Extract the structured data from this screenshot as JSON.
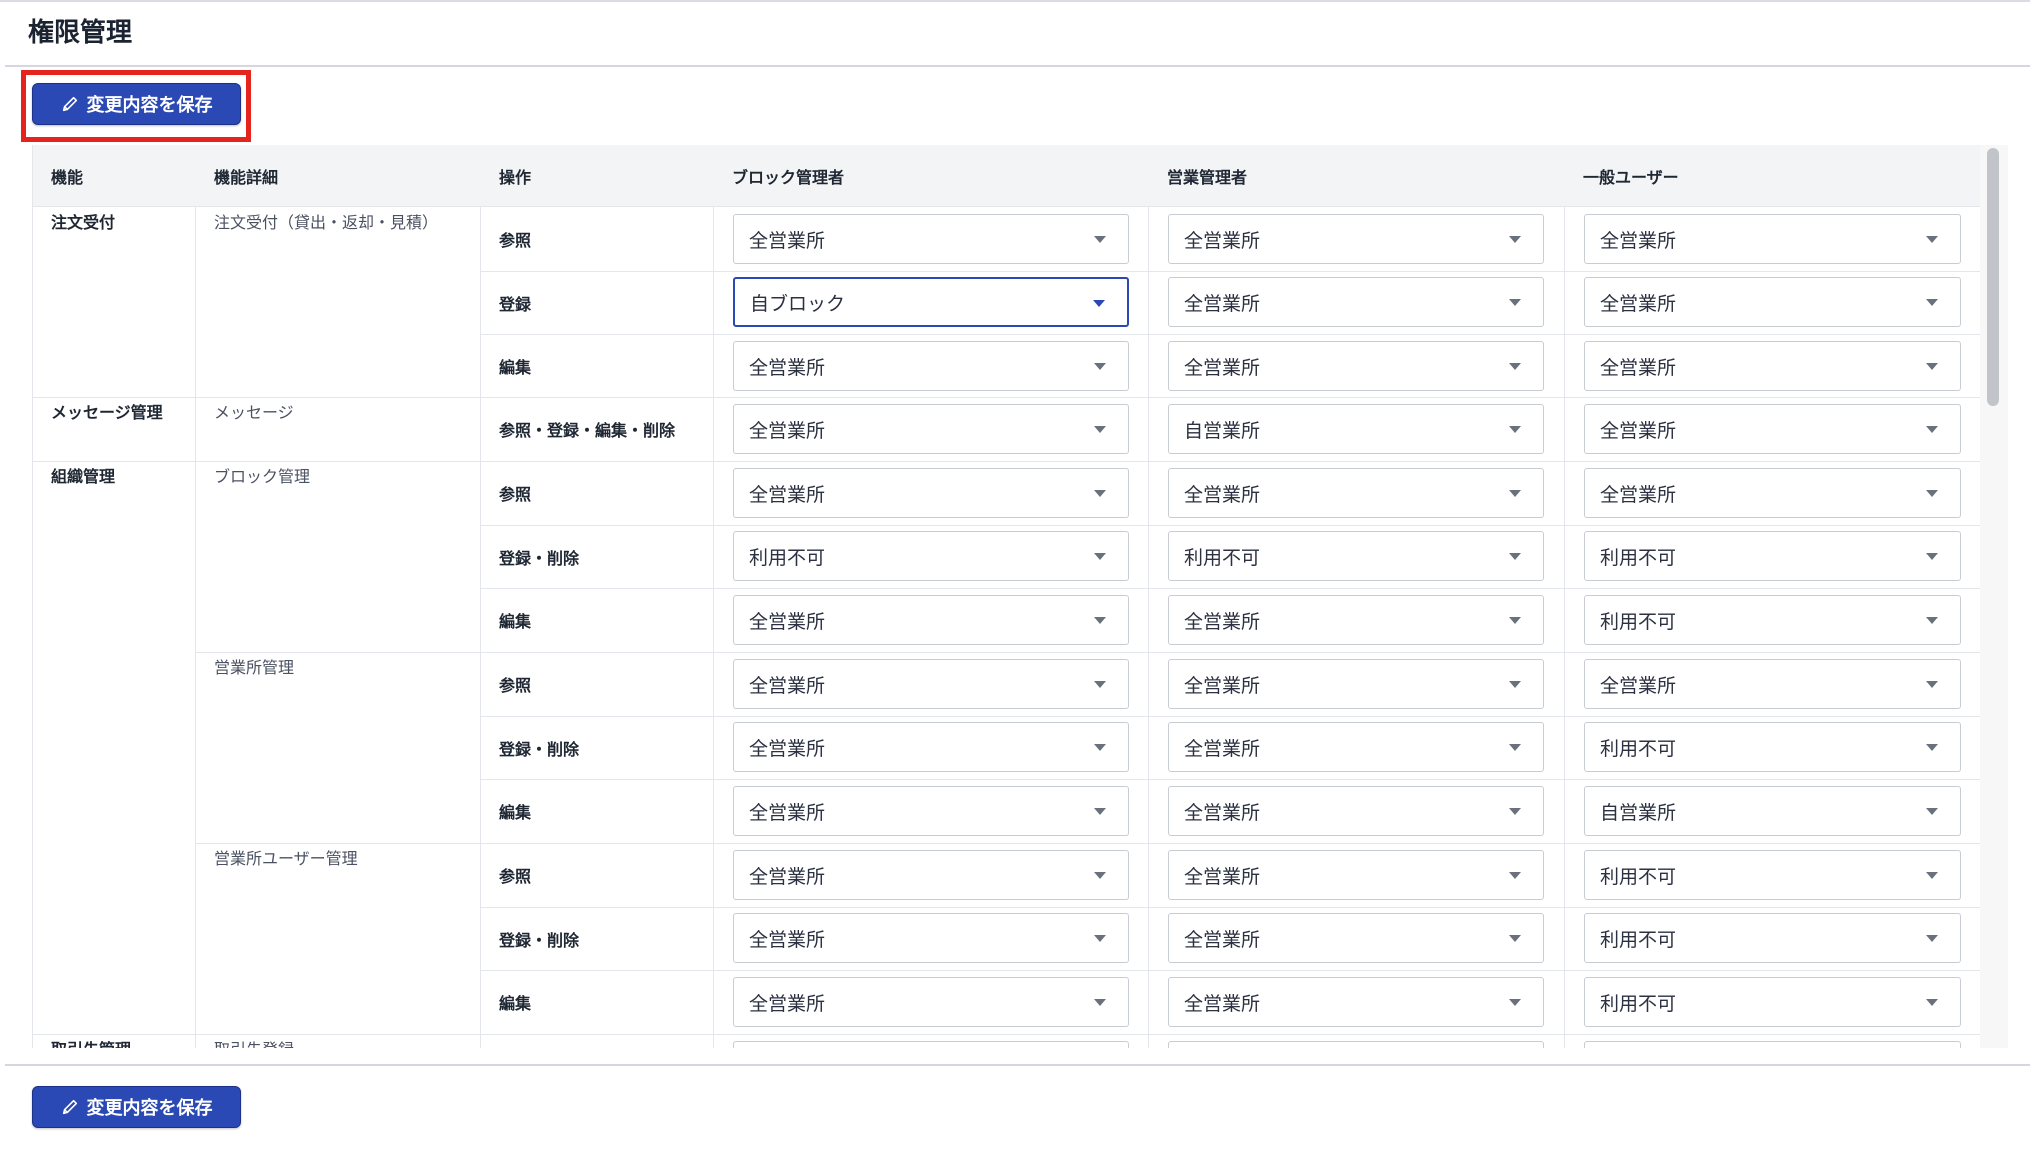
{
  "page": {
    "title": "権限管理"
  },
  "actions": {
    "save_label": "変更内容を保存"
  },
  "table": {
    "headers": {
      "function": "機能",
      "function_detail": "機能詳細",
      "operation": "操作",
      "role_block_admin": "ブロック管理者",
      "role_office_admin": "営業管理者",
      "role_general_user": "一般ユーザー"
    },
    "functions": [
      {
        "label": "注文受付"
      },
      {
        "label": "メッセージ管理"
      },
      {
        "label": "組織管理"
      },
      {
        "label": "取引先管理"
      }
    ],
    "details": [
      {
        "label": "注文受付（貸出・返却・見積）"
      },
      {
        "label": "メッセージ"
      },
      {
        "label": "ブロック管理"
      },
      {
        "label": "営業所管理"
      },
      {
        "label": "営業所ユーザー管理"
      },
      {
        "label": "取引先登録"
      }
    ],
    "rows": [
      {
        "op": "参照",
        "block": "全営業所",
        "office": "全営業所",
        "general": "全営業所"
      },
      {
        "op": "登録",
        "block": "自ブロック",
        "office": "全営業所",
        "general": "全営業所"
      },
      {
        "op": "編集",
        "block": "全営業所",
        "office": "全営業所",
        "general": "全営業所"
      },
      {
        "op": "参照・登録・編集・削除",
        "block": "全営業所",
        "office": "自営業所",
        "general": "全営業所"
      },
      {
        "op": "参照",
        "block": "全営業所",
        "office": "全営業所",
        "general": "全営業所"
      },
      {
        "op": "登録・削除",
        "block": "利用不可",
        "office": "利用不可",
        "general": "利用不可"
      },
      {
        "op": "編集",
        "block": "全営業所",
        "office": "全営業所",
        "general": "利用不可"
      },
      {
        "op": "参照",
        "block": "全営業所",
        "office": "全営業所",
        "general": "全営業所"
      },
      {
        "op": "登録・削除",
        "block": "全営業所",
        "office": "全営業所",
        "general": "利用不可"
      },
      {
        "op": "編集",
        "block": "全営業所",
        "office": "全営業所",
        "general": "自営業所"
      },
      {
        "op": "参照",
        "block": "全営業所",
        "office": "全営業所",
        "general": "利用不可"
      },
      {
        "op": "登録・削除",
        "block": "全営業所",
        "office": "全営業所",
        "general": "利用不可"
      },
      {
        "op": "編集",
        "block": "全営業所",
        "office": "全営業所",
        "general": "利用不可"
      }
    ]
  }
}
